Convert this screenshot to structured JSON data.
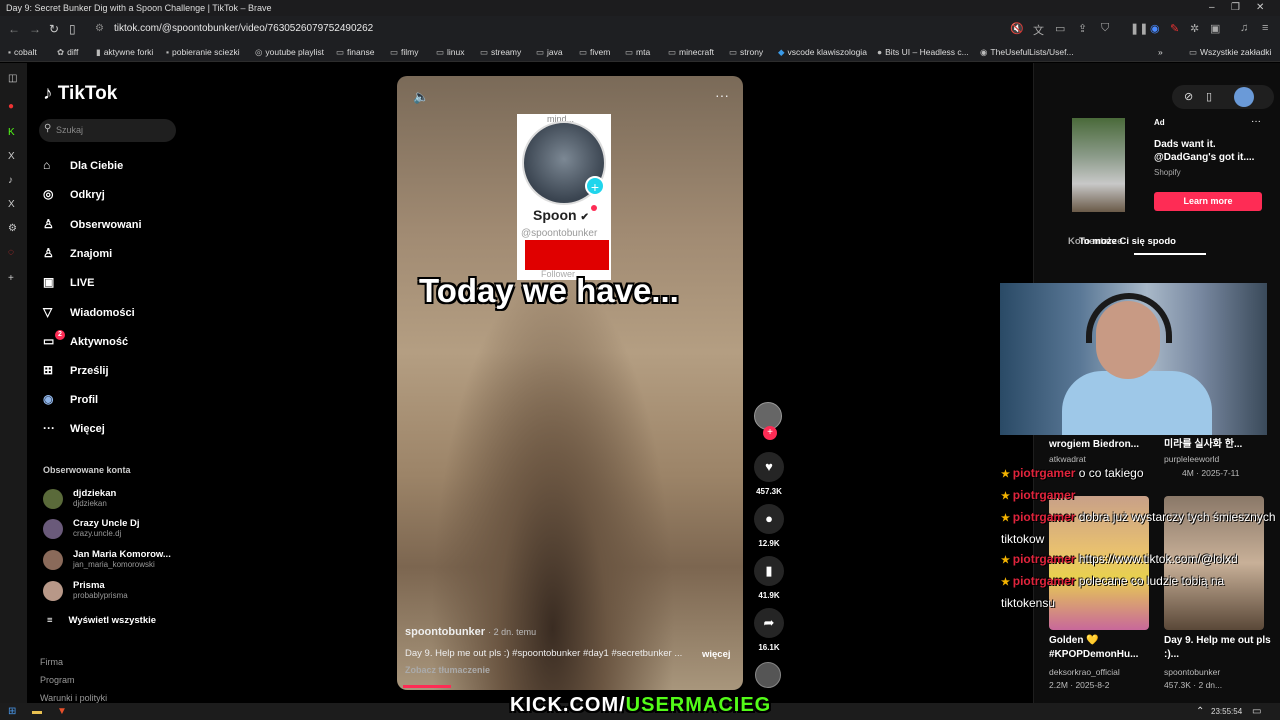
{
  "window": {
    "title": "Day 9: Secret Bunker Dig with a Spoon Challenge | TikTok – Brave"
  },
  "browser": {
    "url": "tiktok.com/@spoontobunker/video/7630526079752490262"
  },
  "bookmarks": [
    "cobalt",
    "diff",
    "aktywne forki",
    "pobieranie sciezki",
    "youtube playlist",
    "finanse",
    "filmy",
    "linux",
    "streamy",
    "java",
    "fivem",
    "mta",
    "minecraft",
    "strony",
    "vscode klawiszologia",
    "Bits UI – Headless c...",
    "TheUsefulLists/Usef...",
    "Wszystkie zakładki"
  ],
  "sidebar": {
    "logo": "TikTok",
    "search_placeholder": "Szukaj",
    "nav": [
      {
        "label": "Dla Ciebie",
        "icon": "home-icon"
      },
      {
        "label": "Odkryj",
        "icon": "compass-icon"
      },
      {
        "label": "Obserwowani",
        "icon": "following-icon"
      },
      {
        "label": "Znajomi",
        "icon": "friends-icon"
      },
      {
        "label": "LIVE",
        "icon": "live-icon"
      },
      {
        "label": "Wiadomości",
        "icon": "messages-icon"
      },
      {
        "label": "Aktywność",
        "icon": "activity-icon",
        "badge": "2"
      },
      {
        "label": "Prześlij",
        "icon": "upload-icon"
      },
      {
        "label": "Profil",
        "icon": "profile-icon"
      },
      {
        "label": "Więcej",
        "icon": "more-icon"
      }
    ],
    "followed_title": "Obserwowane konta",
    "followed": [
      {
        "name": "djdziekan",
        "handle": "djdziekan"
      },
      {
        "name": "Crazy Uncle Dj",
        "handle": "crazy.uncle.dj"
      },
      {
        "name": "Jan Maria Komorow...",
        "handle": "jan_maria_komorowski"
      },
      {
        "name": "Prisma",
        "handle": "probablyprisma"
      }
    ],
    "see_all": "Wyświetl wszystkie",
    "footer": [
      "Firma",
      "Program",
      "Warunki i polityki"
    ]
  },
  "video": {
    "card_text_top": "mind...",
    "card_name": "Spoon",
    "card_handle": "@spoontobunker",
    "card_follower": "Follower",
    "caption": "Today we have...",
    "author": "spoontobunker",
    "posted": "· 2 dn. temu",
    "description": "Day 9. Help me out pls :) #spoontobunker #day1 #secretbunker ...",
    "more": "więcej",
    "translate": "Zobacz tłumaczenie"
  },
  "actions": {
    "likes": "457.3K",
    "comments": "12.9K",
    "saves": "41.9K",
    "shares": "16.1K"
  },
  "ad": {
    "label": "Ad",
    "text": "Dads want it. @DadGang's got it....",
    "advertiser": "Shopify",
    "cta": "Learn more"
  },
  "right_tabs": {
    "comments": "Komentarze",
    "suggested": "To może Ci się spodo"
  },
  "grid": [
    {
      "title": "wrogiem Biedron...",
      "author": "atkwadrat",
      "stats": ""
    },
    {
      "title": "미라를 실사화 한...",
      "author": "purpleleeworld",
      "stats": "4M · 2025-7-11"
    },
    {
      "title": "Golden 💛 #KPOPDemonHu...",
      "author": "deksorkrao_official",
      "stats": "2.2M · 2025-8-2"
    },
    {
      "title": "Day 9. Help me out pls :)...",
      "author": "spoontobunker",
      "stats": "457.3K · 2 dn..."
    }
  ],
  "chat": [
    {
      "user": "piotrgamer",
      "msg": "o co takiego"
    },
    {
      "user": "piotrgamer",
      "msg": ""
    },
    {
      "user": "piotrgamer",
      "msg": "dobra już wystarczy tych śmiesznych tiktokow"
    },
    {
      "user": "piotrgamer",
      "msg": "https://www.tiktok.com/@lolxd"
    },
    {
      "user": "piotrgamer",
      "msg": "polecane co ludzie tobią na tiktokensu"
    }
  ],
  "overlay": {
    "kick_prefix": "KICK.COM/",
    "kick_user": "USERMACIEG"
  },
  "taskbar": {
    "time": "23:55:54"
  }
}
